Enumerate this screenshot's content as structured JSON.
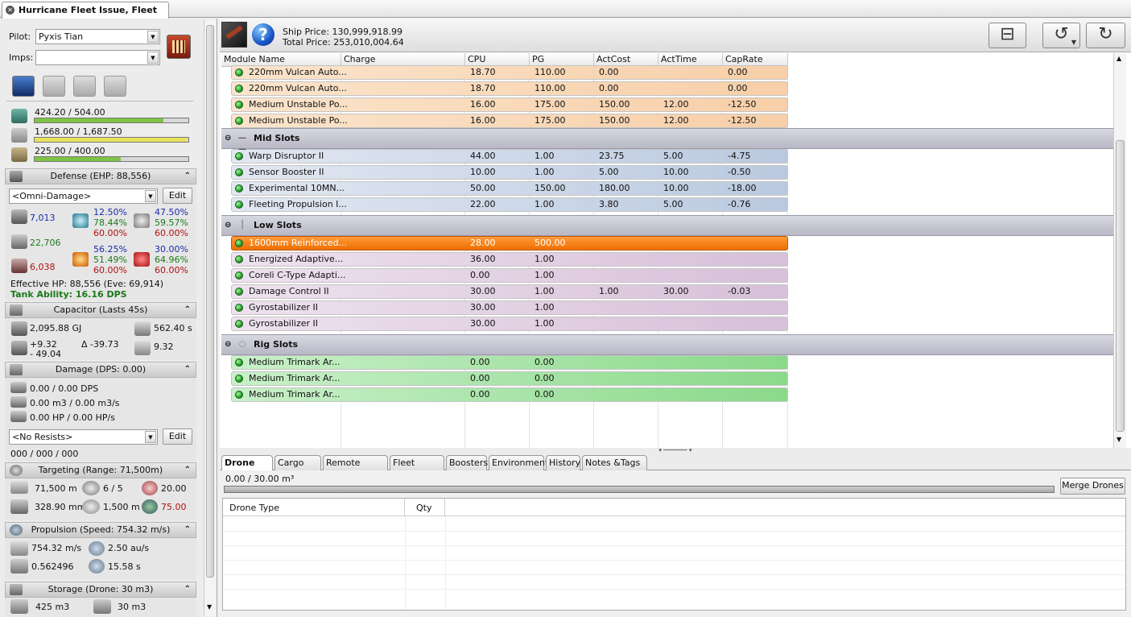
{
  "window_tab": {
    "title": "Hurricane Fleet Issue, Fleet Cane"
  },
  "left": {
    "pilot_label": "Pilot:",
    "pilot_value": "Pyxis Tian",
    "imps_label": "Imps:",
    "imps_value": "",
    "resources": [
      {
        "text": "424.20 / 504.00",
        "fill": 0.84,
        "color": "#7fc445"
      },
      {
        "text": "1,668.00 / 1,687.50",
        "fill": 0.99,
        "color": "#e7e35a"
      },
      {
        "text": "225.00 / 400.00",
        "fill": 0.56,
        "color": "#7fc445"
      }
    ],
    "defense": {
      "header": "Defense (EHP: 88,556)",
      "profile": "<Omni-Damage>",
      "edit": "Edit",
      "shield": "7,013",
      "armor": "22,706",
      "hull": "6,038",
      "res1": [
        "12.50%",
        "78.44%",
        "60.00%"
      ],
      "res2": [
        "47.50%",
        "59.57%",
        "60.00%"
      ],
      "res3": [
        "56.25%",
        "51.49%",
        "60.00%"
      ],
      "res4": [
        "30.00%",
        "64.96%",
        "60.00%"
      ],
      "effective": "Effective HP: 88,556 (Eve: 69,914)",
      "tank": "Tank Ability: 16.16 DPS"
    },
    "capacitor": {
      "header": "Capacitor (Lasts 45s)",
      "capacity": "2,095.88 GJ",
      "recharge": "562.40 s",
      "plus": "+9.32",
      "minus": "- 49.04",
      "delta": "Δ -39.73",
      "peak": "9.32"
    },
    "damage": {
      "header": "Damage (DPS: 0.00)",
      "dps": "0.00 / 0.00 DPS",
      "volley": "0.00 m3 / 0.00 m3/s",
      "hp": "0.00 HP / 0.00 HP/s",
      "resist_profile": "<No Resists>",
      "edit": "Edit",
      "triple": "000 / 000 / 000"
    },
    "targeting": {
      "header": "Targeting (Range: 71,500m)",
      "range": "71,500 m",
      "targets": "6 / 5",
      "scan": "20.00",
      "sig": "328.90 mm",
      "res": "1,500 m",
      "sensor": "75.00"
    },
    "propulsion": {
      "header": "Propulsion (Speed: 754.32 m/s)",
      "speed": "754.32 m/s",
      "warp": "2.50 au/s",
      "agility": "0.562496",
      "align": "15.58 s"
    },
    "storage": {
      "header": "Storage (Drone: 30 m3)",
      "cargo": "425 m3",
      "drone": "30 m3"
    }
  },
  "toolbar": {
    "ship_price": "Ship Price: 130,999,918.99",
    "total_price": "Total Price: 253,010,004.64"
  },
  "columns": [
    "Module Name",
    "Charge",
    "CPU",
    "PG",
    "ActCost",
    "ActTime",
    "CapRate"
  ],
  "racks": {
    "mid": "Mid Slots",
    "low": "Low Slots",
    "rig": "Rig Slots"
  },
  "high": [
    {
      "name": "220mm Vulcan Auto...",
      "cpu": "18.70",
      "pg": "110.00",
      "act": "0.00",
      "time": "",
      "cap": "0.00"
    },
    {
      "name": "220mm Vulcan Auto...",
      "cpu": "18.70",
      "pg": "110.00",
      "act": "0.00",
      "time": "",
      "cap": "0.00"
    },
    {
      "name": "Medium Unstable Po...",
      "cpu": "16.00",
      "pg": "175.00",
      "act": "150.00",
      "time": "12.00",
      "cap": "-12.50"
    },
    {
      "name": "Medium Unstable Po...",
      "cpu": "16.00",
      "pg": "175.00",
      "act": "150.00",
      "time": "12.00",
      "cap": "-12.50"
    }
  ],
  "mid": [
    {
      "name": "Warp Disruptor II",
      "cpu": "44.00",
      "pg": "1.00",
      "act": "23.75",
      "time": "5.00",
      "cap": "-4.75"
    },
    {
      "name": "Sensor Booster II",
      "cpu": "10.00",
      "pg": "1.00",
      "act": "5.00",
      "time": "10.00",
      "cap": "-0.50"
    },
    {
      "name": "Experimental 10MN...",
      "cpu": "50.00",
      "pg": "150.00",
      "act": "180.00",
      "time": "10.00",
      "cap": "-18.00"
    },
    {
      "name": "Fleeting Propulsion I...",
      "cpu": "22.00",
      "pg": "1.00",
      "act": "3.80",
      "time": "5.00",
      "cap": "-0.76"
    }
  ],
  "low": [
    {
      "name": "1600mm Reinforced...",
      "cpu": "28.00",
      "pg": "500.00",
      "act": "",
      "time": "",
      "cap": ""
    },
    {
      "name": "Energized Adaptive...",
      "cpu": "36.00",
      "pg": "1.00",
      "act": "",
      "time": "",
      "cap": ""
    },
    {
      "name": "Coreli C-Type Adapti...",
      "cpu": "0.00",
      "pg": "1.00",
      "act": "",
      "time": "",
      "cap": ""
    },
    {
      "name": "Damage Control II",
      "cpu": "30.00",
      "pg": "1.00",
      "act": "1.00",
      "time": "30.00",
      "cap": "-0.03"
    },
    {
      "name": "Gyrostabilizer II",
      "cpu": "30.00",
      "pg": "1.00",
      "act": "",
      "time": "",
      "cap": ""
    },
    {
      "name": "Gyrostabilizer II",
      "cpu": "30.00",
      "pg": "1.00",
      "act": "",
      "time": "",
      "cap": ""
    }
  ],
  "rig": [
    {
      "name": "Medium Trimark Ar...",
      "cpu": "0.00",
      "pg": "0.00",
      "act": "",
      "time": "",
      "cap": ""
    },
    {
      "name": "Medium Trimark Ar...",
      "cpu": "0.00",
      "pg": "0.00",
      "act": "",
      "time": "",
      "cap": ""
    },
    {
      "name": "Medium Trimark Ar...",
      "cpu": "0.00",
      "pg": "0.00",
      "act": "",
      "time": "",
      "cap": ""
    }
  ],
  "bottom_tabs": [
    "Drone Bay",
    "Cargo Bay",
    "Remote Effects",
    "Fleet Effects",
    "Boosters",
    "Environment",
    "History",
    "Notes &Tags"
  ],
  "drone_bay": {
    "volume": "0.00 / 30.00 m³",
    "merge": "Merge Drones",
    "col_type": "Drone Type",
    "col_qty": "Qty"
  }
}
